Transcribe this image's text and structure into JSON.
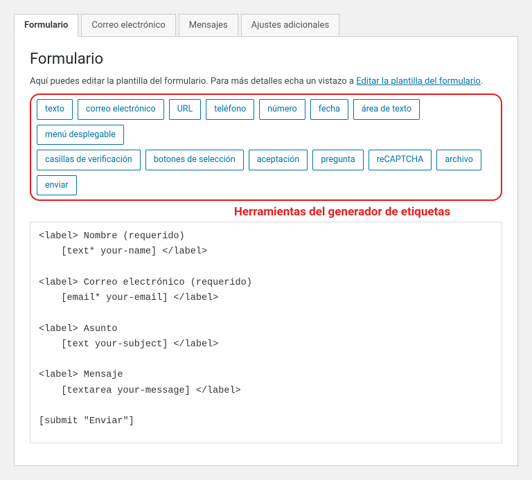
{
  "tabs": {
    "items": [
      {
        "label": "Formulario",
        "active": true
      },
      {
        "label": "Correo electrónico",
        "active": false
      },
      {
        "label": "Mensajes",
        "active": false
      },
      {
        "label": "Ajustes adicionales",
        "active": false
      }
    ]
  },
  "panel": {
    "title": "Formulario",
    "description_prefix": "Aquí puedes editar la plantilla del formulario. Para más detalles echa un vistazo a ",
    "description_link": "Editar la plantilla del formulario",
    "description_suffix": "."
  },
  "tag_generator": {
    "row1": [
      "texto",
      "correo electrónico",
      "URL",
      "teléfono",
      "número",
      "fecha",
      "área de texto",
      "menú desplegable"
    ],
    "row2": [
      "casillas de verificación",
      "botones de selección",
      "aceptación",
      "pregunta",
      "reCAPTCHA",
      "archivo",
      "enviar"
    ]
  },
  "annotation": "Herramientas del generador de etiquetas",
  "form_template": "<label> Nombre (requerido)\n    [text* your-name] </label>\n\n<label> Correo electrónico (requerido)\n    [email* your-email] </label>\n\n<label> Asunto\n    [text your-subject] </label>\n\n<label> Mensaje\n    [textarea your-message] </label>\n\n[submit \"Enviar\"]"
}
